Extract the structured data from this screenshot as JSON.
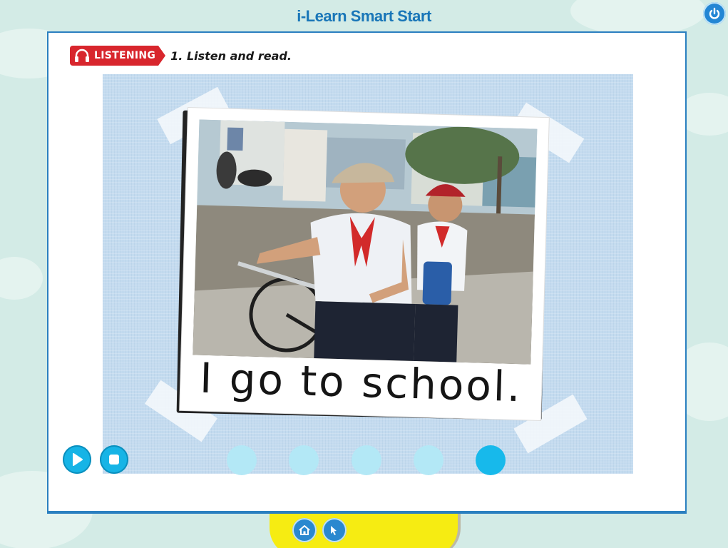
{
  "app": {
    "title": "i-Learn Smart Start"
  },
  "activity": {
    "badge_label": "LISTENING",
    "instruction": "1. Listen and read."
  },
  "card": {
    "caption": "I go to school."
  },
  "controls": {
    "icons": [
      "play-icon",
      "stop-icon"
    ]
  },
  "pagination": {
    "page_count": 5,
    "current_page": 5
  },
  "nav": {
    "icons": [
      "home-icon",
      "back-icon",
      "power-icon"
    ]
  },
  "colors": {
    "accent_blue": "#16b4e6",
    "title_blue": "#1976b8",
    "badge_red": "#d8262d",
    "bar_yellow": "#f6ec12"
  }
}
